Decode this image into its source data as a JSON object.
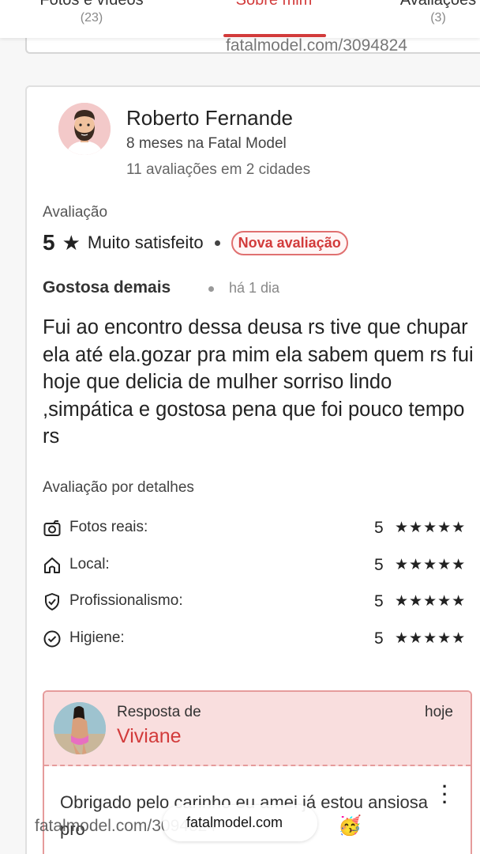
{
  "tabs": [
    {
      "label": "Fotos e vídeos",
      "count": "(23)"
    },
    {
      "label": "Sobre mim",
      "count": ""
    },
    {
      "label": "Avaliações",
      "count": "(3)"
    }
  ],
  "watermark": {
    "top": "fatalmodel.com/3094824",
    "bottom": "fatalmodel.com/3094824",
    "pill": "fatalmodel.com"
  },
  "review": {
    "author": "Roberto Fernande",
    "membership": "8 meses na Fatal Model",
    "review_count": "11 avaliações em 2 cidades",
    "rating_label": "Avaliação",
    "rating_value": "5",
    "rating_star": "★",
    "rating_text": "Muito satisfeito",
    "badge": "Nova avaliação",
    "title": "Gostosa demais",
    "time": "há 1 dia",
    "body": "Fui ao encontro dessa deusa rs tive que chupar ela até ela.gozar pra mim ela sabem quem rs fui hoje que delicia de mulher sorriso lindo ,simpática e gostosa pena que foi pouco tempo rs",
    "details_label": "Avaliação por detalhes",
    "details": [
      {
        "label": "Fotos reais:",
        "score": "5",
        "stars": "★★★★★",
        "icon": "camera-icon"
      },
      {
        "label": "Local:",
        "score": "5",
        "stars": "★★★★★",
        "icon": "home-icon"
      },
      {
        "label": "Profissionalismo:",
        "score": "5",
        "stars": "★★★★★",
        "icon": "shield-check-icon"
      },
      {
        "label": "Higiene:",
        "score": "5",
        "stars": "★★★★★",
        "icon": "check-circle-icon"
      }
    ]
  },
  "reply": {
    "from_label": "Resposta de",
    "name": "Viviane",
    "date": "hoje",
    "body": "Obrigado pelo carinho eu amei já estou ansiosa pro",
    "emoji": "🥳"
  },
  "colors": {
    "accent": "#d23b3b",
    "reply_bg": "#f9dede",
    "reply_border": "#e59b9b"
  }
}
